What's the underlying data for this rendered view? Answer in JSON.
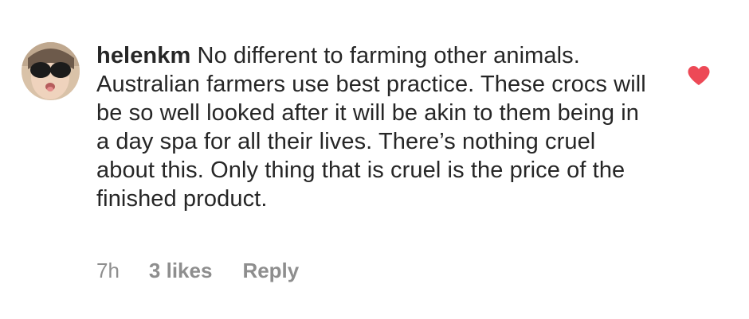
{
  "comment": {
    "username": "helenkm",
    "text": "No different to farming other animals. Australian farmers use best practice. These crocs will be so well looked after it will be akin to them being in a day spa for all their lives. There’s nothing cruel about this. Only thing that is cruel is the price of the finished product.",
    "time": "7h",
    "likes": "3 likes",
    "reply_label": "Reply",
    "liked": true,
    "like_icon": "heart-icon",
    "like_color": "#ed4956"
  }
}
